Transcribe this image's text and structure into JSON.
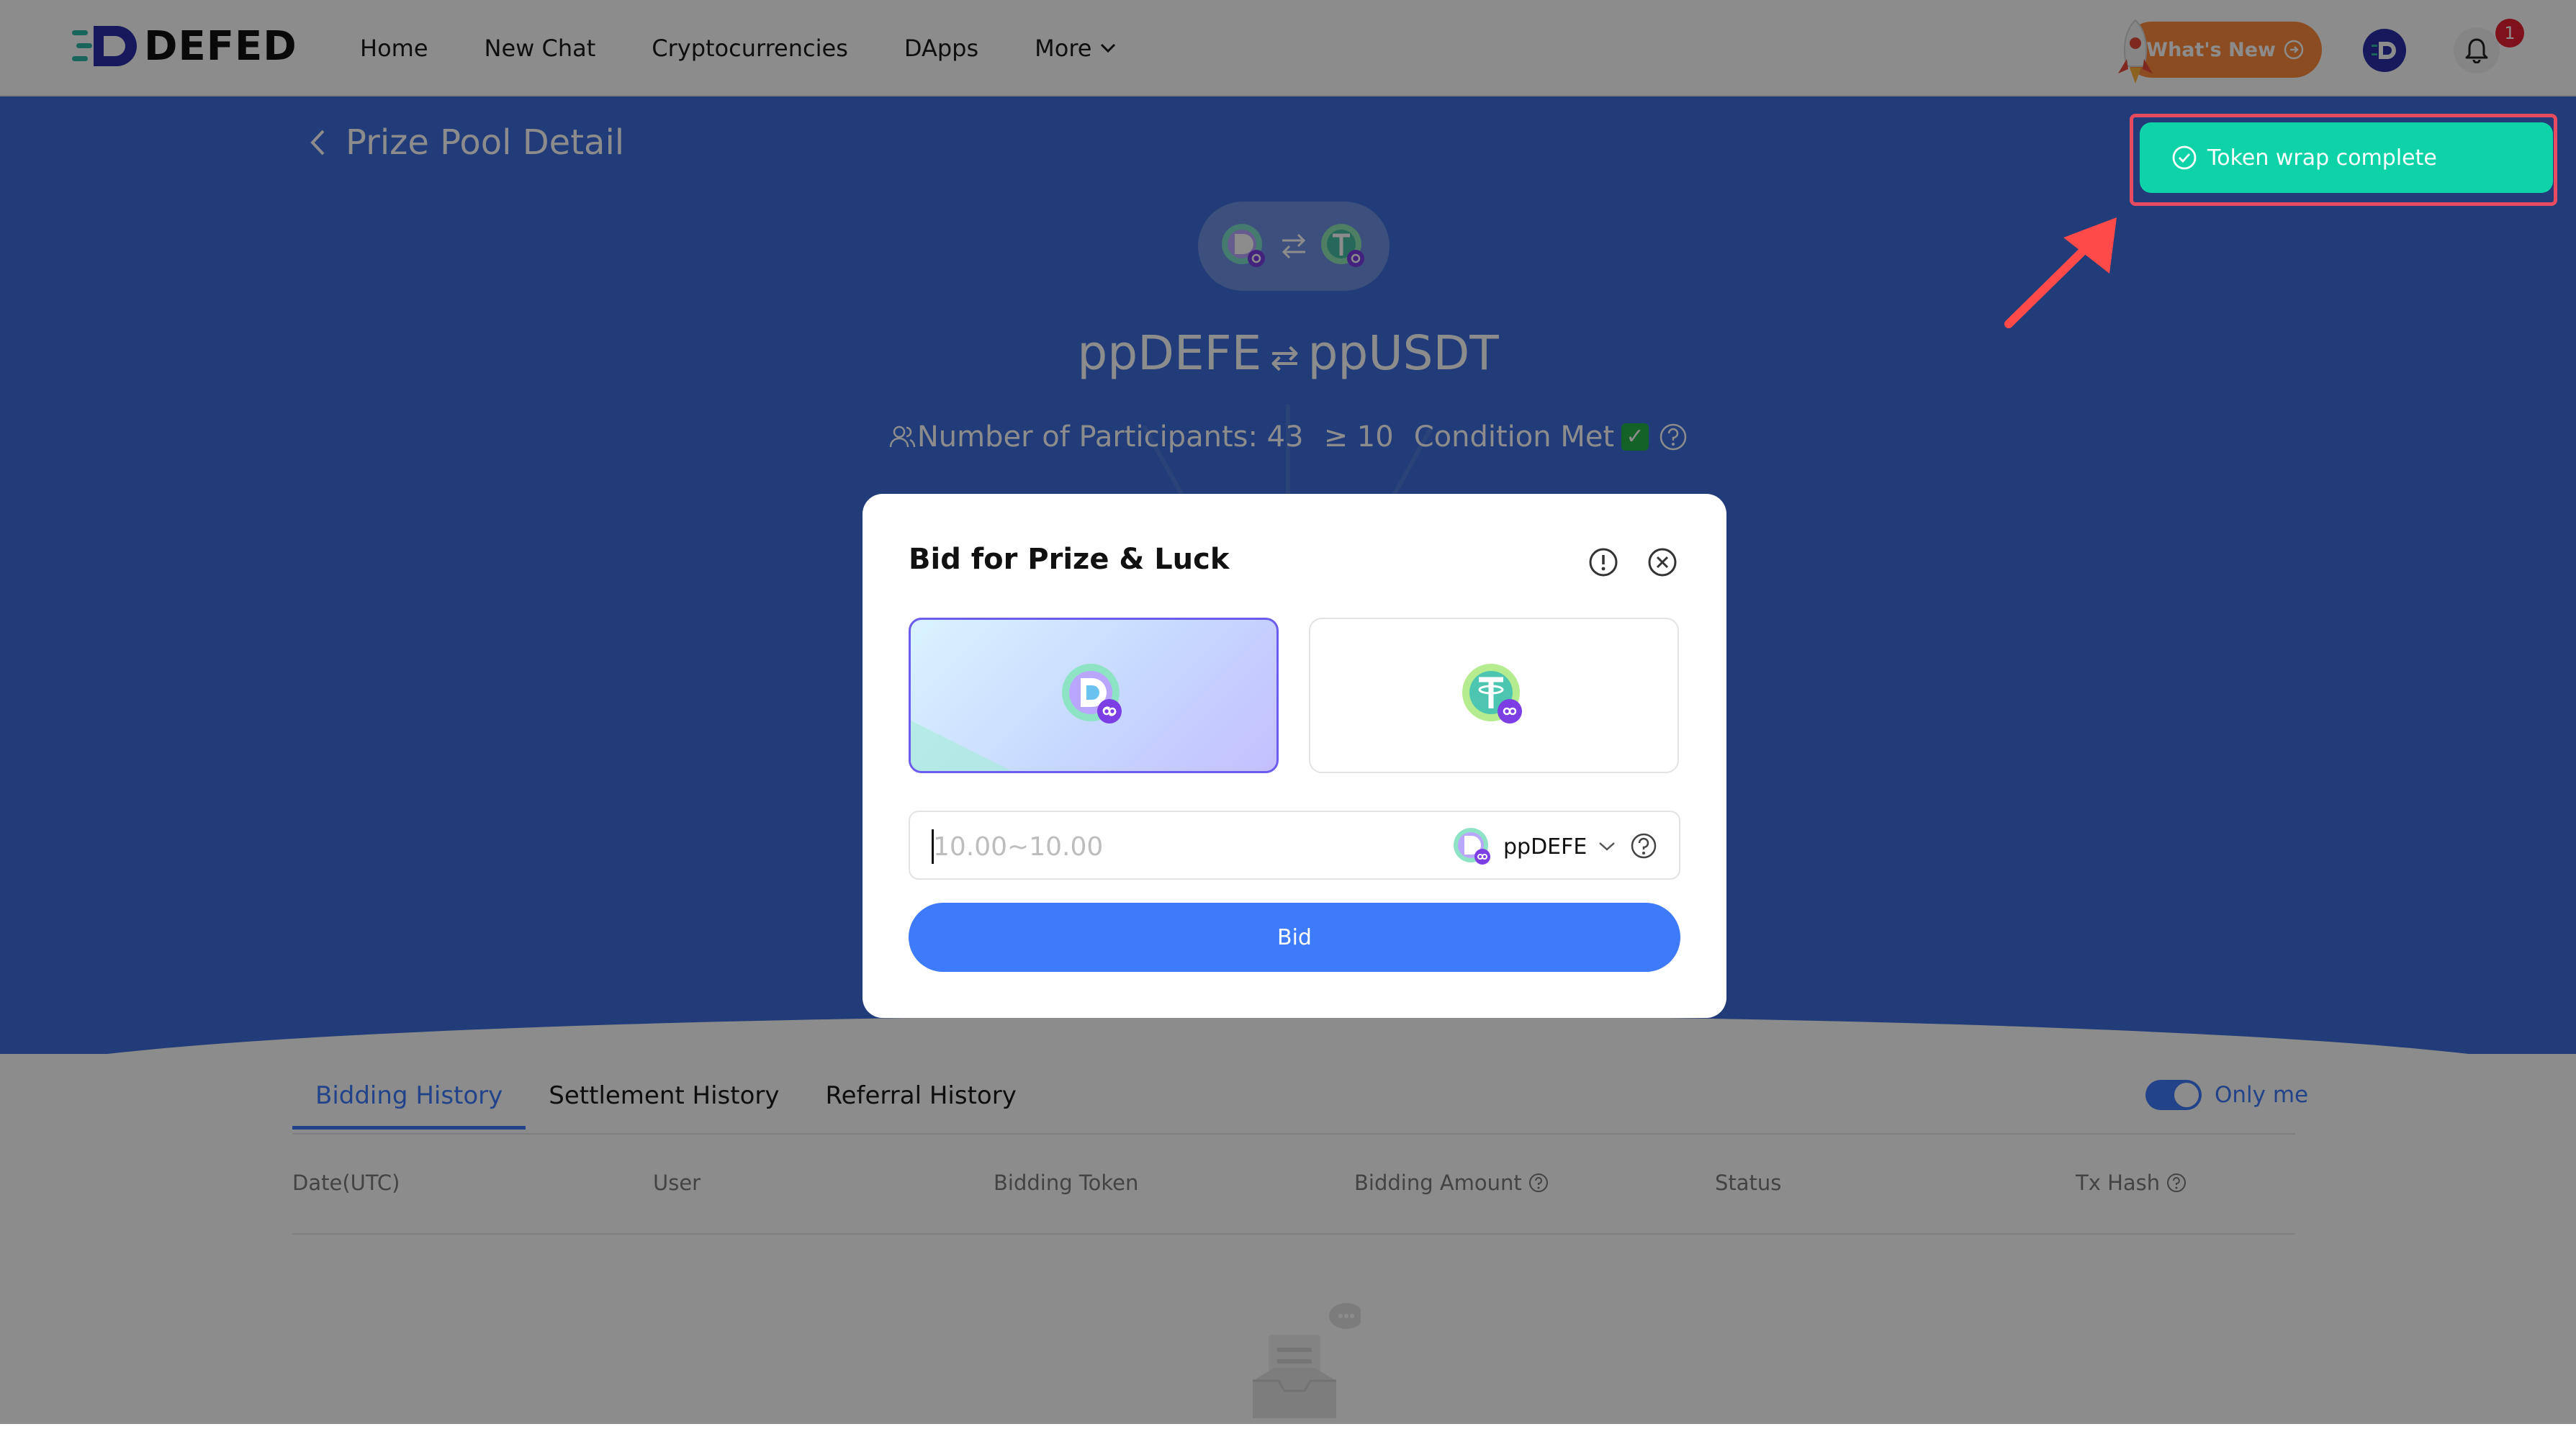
{
  "brand": {
    "name": "DEFED"
  },
  "nav": {
    "items": [
      {
        "label": "Home"
      },
      {
        "label": "New Chat"
      },
      {
        "label": "Cryptocurrencies"
      },
      {
        "label": "DApps"
      },
      {
        "label": "More"
      }
    ],
    "whats_new": "What's New",
    "notification_count": "1"
  },
  "page": {
    "back_title": "Prize Pool Detail",
    "pair": {
      "from": "ppDEFE",
      "swap_symbol": "⇄",
      "to": "ppUSDT"
    },
    "participants_label": "Number of Participants: 43",
    "threshold": "≥ 10",
    "condition": "Condition Met",
    "condition_check": "✓"
  },
  "modal": {
    "title": "Bid for Prize & Luck",
    "amount_placeholder": "10.00~10.00",
    "selected_token": "ppDEFE",
    "bid_label": "Bid"
  },
  "toast": {
    "message": "Token wrap complete"
  },
  "history": {
    "tabs": [
      {
        "label": "Bidding History"
      },
      {
        "label": "Settlement History"
      },
      {
        "label": "Referral History"
      }
    ],
    "only_me": "Only me",
    "columns": [
      {
        "label": "Date(UTC)"
      },
      {
        "label": "User"
      },
      {
        "label": "Bidding Token"
      },
      {
        "label": "Bidding Amount"
      },
      {
        "label": "Status"
      },
      {
        "label": "Tx Hash"
      }
    ]
  },
  "colors": {
    "primary": "#3e7bfa",
    "hero": "#3d6ddb",
    "toast": "#0fd3a8",
    "highlight": "#e84a5f",
    "whats_new": "#ff8a3d"
  }
}
